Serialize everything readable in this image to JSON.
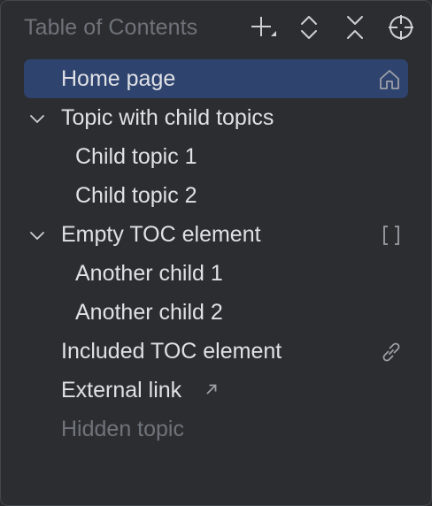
{
  "panel": {
    "title": "Table of Contents"
  },
  "toolbar": {
    "add": "add-icon",
    "expand_all": "expand-all-icon",
    "collapse_all": "collapse-all-icon",
    "locate": "locate-icon"
  },
  "tree": {
    "items": [
      {
        "label": "Home page",
        "level": 0,
        "selected": true,
        "right_icon": "home-icon"
      },
      {
        "label": "Topic with child topics",
        "level": 0,
        "expanded": true
      },
      {
        "label": "Child topic 1",
        "level": 1
      },
      {
        "label": "Child topic 2",
        "level": 1
      },
      {
        "label": "Empty TOC element",
        "level": 0,
        "expanded": true,
        "right_icon": "empty-element-icon"
      },
      {
        "label": "Another child 1",
        "level": 1
      },
      {
        "label": "Another child 2",
        "level": 1
      },
      {
        "label": "Included TOC element",
        "level": 0,
        "right_icon": "link-icon"
      },
      {
        "label": "External link",
        "level": 0,
        "inline_icon": "external-link-arrow-icon"
      },
      {
        "label": "Hidden topic",
        "level": 0,
        "hidden": true
      }
    ]
  },
  "colors": {
    "background": "#2b2d30",
    "selection": "#2e436e",
    "text": "#dfe1e5",
    "muted_text": "#6f737a",
    "icon": "#ced0d6"
  }
}
